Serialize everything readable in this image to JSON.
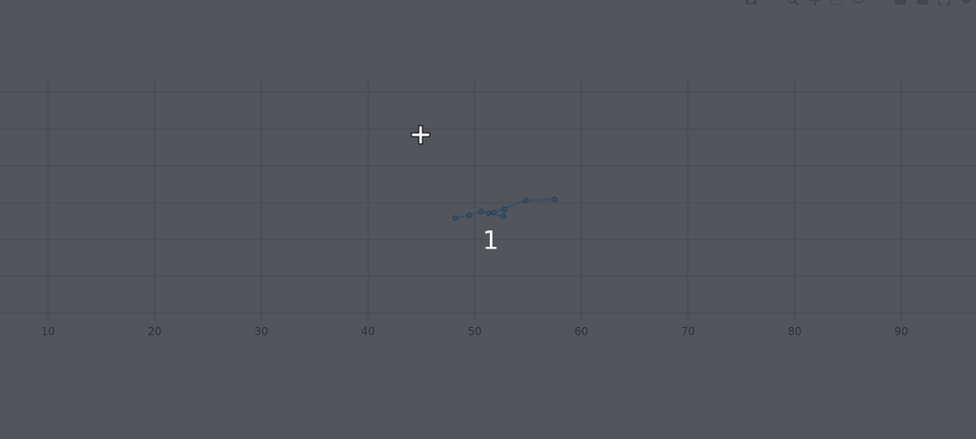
{
  "chart_data": {
    "type": "scatter",
    "mode": "lines+markers",
    "xlim": [
      5.5,
      97
    ],
    "ylim": [
      -2.2,
      4.4
    ],
    "xticks": [
      10,
      20,
      30,
      40,
      50,
      60,
      70,
      80,
      90
    ],
    "tick_labels": [
      "10",
      "20",
      "30",
      "40",
      "50",
      "60",
      "70",
      "80",
      "90"
    ],
    "grid": true,
    "series": [
      {
        "color": "#36506a",
        "x": [
          48.2,
          49.5,
          50.6,
          51.3,
          52.7,
          52.8,
          51.8,
          54.8,
          57.5
        ],
        "y": [
          0.58,
          0.66,
          0.76,
          0.72,
          0.63,
          0.82,
          0.74,
          1.06,
          1.09
        ]
      }
    ],
    "annotations": [
      {
        "text": "1",
        "x": 51.5,
        "y": 0.0
      }
    ]
  },
  "modebar": {
    "icons": [
      "camera-icon",
      "zoom-icon",
      "pan-icon",
      "box-select-icon",
      "lasso-icon",
      "zoom-in-icon",
      "zoom-out-icon",
      "autoscale-icon",
      "reset-axes-icon"
    ]
  },
  "colors": {
    "background": "#52555c",
    "grid": "#4a4c50",
    "tick_text": "#2f3237",
    "series": "#36506a",
    "annotation": "#ffffff"
  }
}
